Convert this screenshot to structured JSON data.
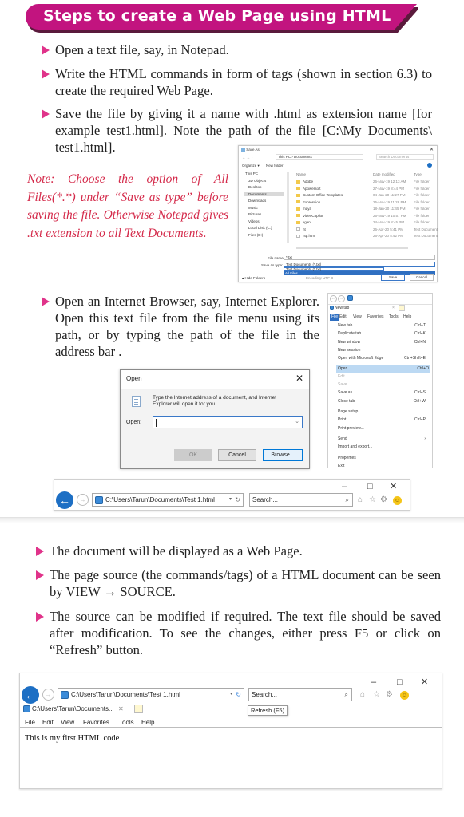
{
  "header": {
    "title": "Steps to create a Web Page using HTML",
    "color": "#c2147f"
  },
  "steps": [
    "Open a text file, say, in Notepad.",
    "Write the HTML commands in form of tags (shown in section 6.3) to create the required Web Page.",
    "Save the file by giving it a name with .html as extension name [for example test1.html]. Note the path of the file [C:\\My Documents\\ test1.html].",
    "Open an Internet Browser, say, Internet Explorer. Open this text file from the file menu using its path, or by typing the path of the file in the address bar .",
    "The document will be displayed as a Web Page.",
    "The page source (the commands/tags) of a HTML document can be seen by VIEW → SOURCE.",
    "The source can be modified if required. The text file should be saved after modification. To see the changes, either press F5 or click on “Refresh” button."
  ],
  "note": "Note: Choose the option of All Files(*.*) under “Save as type” before saving the file. Otherwise Notepad gives .txt extension to all Text Documents.",
  "save_as_dialog": {
    "title": "Save As",
    "breadcrumb": "This PC › Documents",
    "search_placeholder": "Search Documents",
    "organize": "Organize ▾",
    "new_folder": "New folder",
    "nav_items": [
      "This PC",
      "3D Objects",
      "Desktop",
      "Documents",
      "Downloads",
      "Music",
      "Pictures",
      "Videos",
      "Local Disk (C:)",
      "Files (D:)"
    ],
    "columns": [
      "Name",
      "Date modified",
      "Type"
    ],
    "files": [
      {
        "name": "Adobe",
        "date": "26-Nov-19 12:13 AM",
        "type": "File folder"
      },
      {
        "name": "Apowersoft",
        "date": "27-Nov-19 8:44 PM",
        "type": "File folder"
      },
      {
        "name": "Custom Office Templates",
        "date": "04-Jan-20 11:27 PM",
        "type": "File folder"
      },
      {
        "name": "Expression",
        "date": "25-Nov-19 11:28 PM",
        "type": "File folder"
      },
      {
        "name": "maya",
        "date": "18-Jan-20 11:45 PM",
        "type": "File folder"
      },
      {
        "name": "VideoCopilot",
        "date": "25-Nov-19 10:57 PM",
        "type": "File folder"
      },
      {
        "name": "xgen",
        "date": "24-Nov-19 8:45 PM",
        "type": "File folder"
      },
      {
        "name": "ht",
        "date": "26-Apr-20 5:41 PM",
        "type": "Text Document"
      },
      {
        "name": "htp.html",
        "date": "26-Apr-20 5:42 PM",
        "type": "Text Document"
      }
    ],
    "file_name_label": "File name:",
    "file_name_value": "*.txt",
    "save_type_label": "Save as type:",
    "save_type_value": "Text Documents (*.txt)",
    "save_type_options": [
      "Text Documents (*.txt)",
      "All Files"
    ],
    "hide_folders": "▴ Hide Folders",
    "encoding_label": "Encoding:",
    "encoding_value": "UTF-8",
    "save_button": "Save",
    "cancel_button": "Cancel"
  },
  "ie_file_menu": {
    "tab_label": "New tab",
    "menubar": [
      "File",
      "Edit",
      "View",
      "Favorites",
      "Tools",
      "Help"
    ],
    "items": [
      {
        "label": "New tab",
        "shortcut": "Ctrl+T",
        "state": "normal"
      },
      {
        "label": "Duplicate tab",
        "shortcut": "Ctrl+K",
        "state": "normal"
      },
      {
        "label": "New window",
        "shortcut": "Ctrl+N",
        "state": "normal"
      },
      {
        "label": "New session",
        "shortcut": "",
        "state": "normal"
      },
      {
        "label": "Open with Microsoft Edge",
        "shortcut": "Ctrl+Shift+E",
        "state": "normal"
      },
      {
        "label": "Open...",
        "shortcut": "Ctrl+O",
        "state": "highlighted"
      },
      {
        "label": "Edit",
        "shortcut": "",
        "state": "disabled"
      },
      {
        "label": "Save",
        "shortcut": "",
        "state": "disabled"
      },
      {
        "label": "Save as...",
        "shortcut": "Ctrl+S",
        "state": "normal"
      },
      {
        "label": "Close tab",
        "shortcut": "Ctrl+W",
        "state": "normal"
      },
      {
        "label": "Page setup...",
        "shortcut": "",
        "state": "normal"
      },
      {
        "label": "Print...",
        "shortcut": "Ctrl+P",
        "state": "normal"
      },
      {
        "label": "Print preview...",
        "shortcut": "",
        "state": "normal"
      },
      {
        "label": "Send",
        "shortcut": "›",
        "state": "normal"
      },
      {
        "label": "Import and export...",
        "shortcut": "",
        "state": "normal"
      },
      {
        "label": "Properties",
        "shortcut": "",
        "state": "normal"
      },
      {
        "label": "Exit",
        "shortcut": "",
        "state": "normal"
      }
    ]
  },
  "open_dialog": {
    "title": "Open",
    "message": "Type the Internet address of a document, and Internet Explorer will open it for you.",
    "open_label": "Open:",
    "open_value": "",
    "ok": "OK",
    "cancel": "Cancel",
    "browse": "Browse..."
  },
  "browser_bar_1": {
    "address": "C:\\Users\\Tarun\\Documents\\Test 1.html",
    "search_placeholder": "Search..."
  },
  "browser_window_2": {
    "address": "C:\\Users\\Tarun\\Documents\\Test 1.html",
    "search_placeholder": "Search...",
    "tab_label": "C:\\Users\\Tarun\\Documents...",
    "tooltip": "Refresh (F5)",
    "menubar": [
      "File",
      "Edit",
      "View",
      "Favorites",
      "Tools",
      "Help"
    ],
    "content": "This is my first HTML code"
  },
  "icons": {
    "back": "←",
    "forward": "→",
    "refresh": "↻",
    "search": "⌕",
    "home": "⌂",
    "star": "☆",
    "gear": "⚙",
    "smiley": "☺",
    "close": "✕",
    "minimize": "–",
    "maximize": "□",
    "dropdown": "▾"
  }
}
